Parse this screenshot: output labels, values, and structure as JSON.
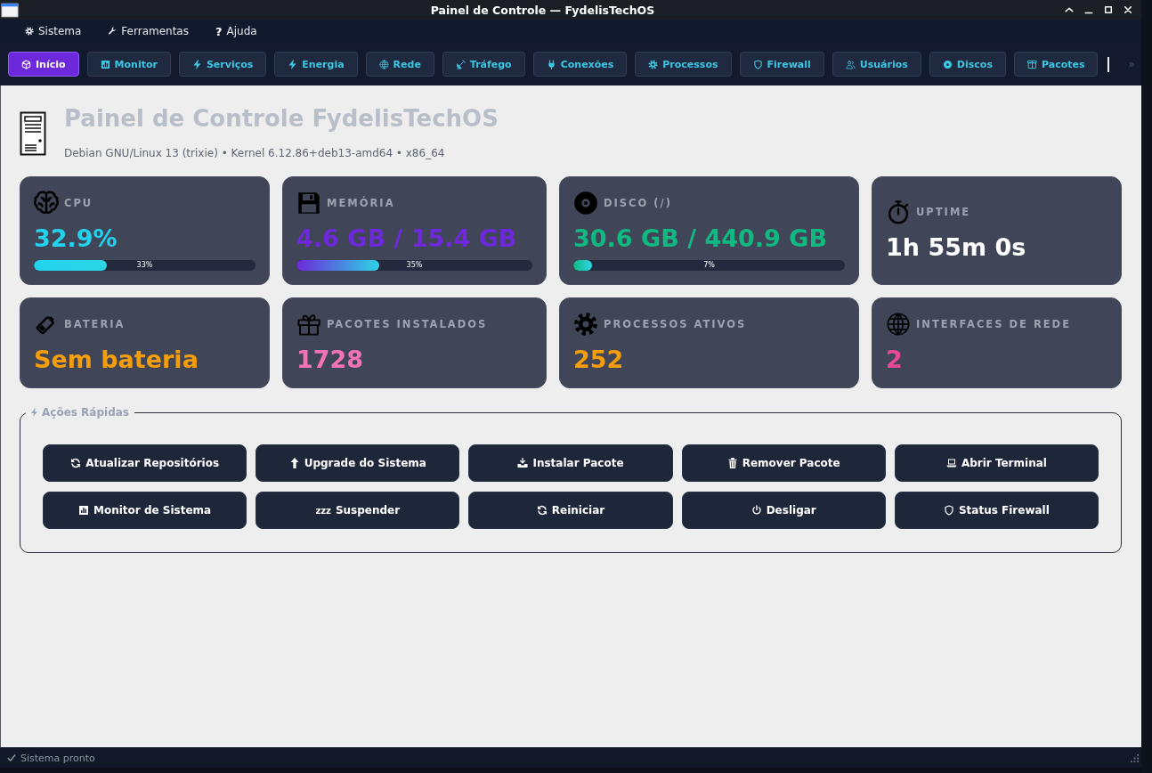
{
  "window": {
    "title": "Painel de Controle — FydelisTechOS"
  },
  "menu": [
    {
      "label": "Sistema"
    },
    {
      "label": "Ferramentas"
    },
    {
      "label": "Ajuda",
      "glyph": "?"
    }
  ],
  "tabs": [
    {
      "label": "Início",
      "selected": true
    },
    {
      "label": "Monitor",
      "selected": false
    },
    {
      "label": "Serviços",
      "selected": false
    },
    {
      "label": "Energia",
      "selected": false
    },
    {
      "label": "Rede",
      "selected": false
    },
    {
      "label": "Tráfego",
      "selected": false
    },
    {
      "label": "Conexões",
      "selected": false
    },
    {
      "label": "Processos",
      "selected": false
    },
    {
      "label": "Firewall",
      "selected": false
    },
    {
      "label": "Usuários",
      "selected": false
    },
    {
      "label": "Discos",
      "selected": false
    },
    {
      "label": "Pacotes",
      "selected": false
    }
  ],
  "tab_overflow": "»",
  "header": {
    "title": "Painel de Controle FydelisTechOS",
    "subtitle": "Debian GNU/Linux 13 (trixie) • Kernel 6.12.86+deb13-amd64 • x86_64"
  },
  "cards": [
    {
      "label": "CPU",
      "value": "32.9%",
      "color": "#22d3ee",
      "progress": {
        "level": 0.33,
        "text": "33%"
      }
    },
    {
      "label": "MEMÓRIA",
      "value": "4.6 GB / 15.4 GB",
      "color": "#6d28d9",
      "progress": {
        "level": 0.35,
        "text": "35%"
      }
    },
    {
      "label": "DISCO (/)",
      "value": "30.6 GB / 440.9 GB",
      "color": "#10b981",
      "progress": {
        "level": 0.07,
        "text": "7%"
      }
    },
    {
      "label": "UPTIME",
      "value": "1h 55m 0s",
      "color": "#ffffff"
    },
    {
      "label": "BATERIA",
      "value": "Sem bateria",
      "color": "#f59e0b"
    },
    {
      "label": "PACOTES INSTALADOS",
      "value": "1728",
      "color": "#f472b6"
    },
    {
      "label": "PROCESSOS ATIVOS",
      "value": "252",
      "color": "#f59e0b"
    },
    {
      "label": "INTERFACES DE REDE",
      "value": "2",
      "color": "#ec4899"
    }
  ],
  "quick_actions": {
    "title": "Ações Rápidas",
    "buttons": [
      {
        "label": "Atualizar Repositórios"
      },
      {
        "label": "Upgrade do Sistema"
      },
      {
        "label": "Instalar Pacote"
      },
      {
        "label": "Remover Pacote"
      },
      {
        "label": "Abrir Terminal"
      },
      {
        "label": "Monitor de Sistema"
      },
      {
        "label": "Suspender",
        "glyph": "zzz"
      },
      {
        "label": "Reiniciar"
      },
      {
        "label": "Desligar"
      },
      {
        "label": "Status Firewall"
      }
    ]
  },
  "status_bar": {
    "text": "Sistema pronto"
  }
}
